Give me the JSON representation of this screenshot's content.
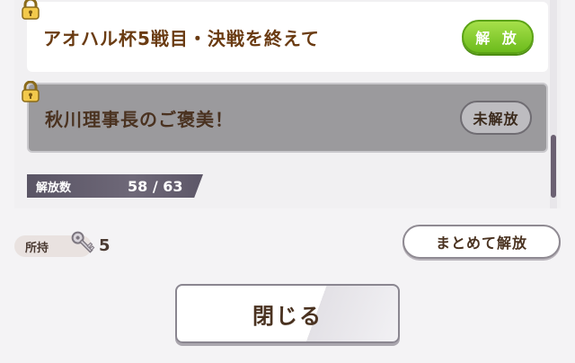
{
  "stories": [
    {
      "title": "アオハル杯5戦目・決戦を終えて",
      "button_label": "解 放",
      "state": "unlockable"
    },
    {
      "title": "秋川理事長のご褒美！",
      "button_label": "未解放",
      "state": "locked"
    }
  ],
  "progress": {
    "label": "解放数",
    "value": "58 /  63"
  },
  "inventory": {
    "label": "所持",
    "count": "5",
    "icon": "key-icon"
  },
  "actions": {
    "bulk_unlock_label": "まとめて解放",
    "close_label": "閉じる"
  },
  "colors": {
    "accent_green": "#6cbb1c",
    "title_brown": "#6a3b12",
    "locked_gray": "#9b9a9d"
  }
}
